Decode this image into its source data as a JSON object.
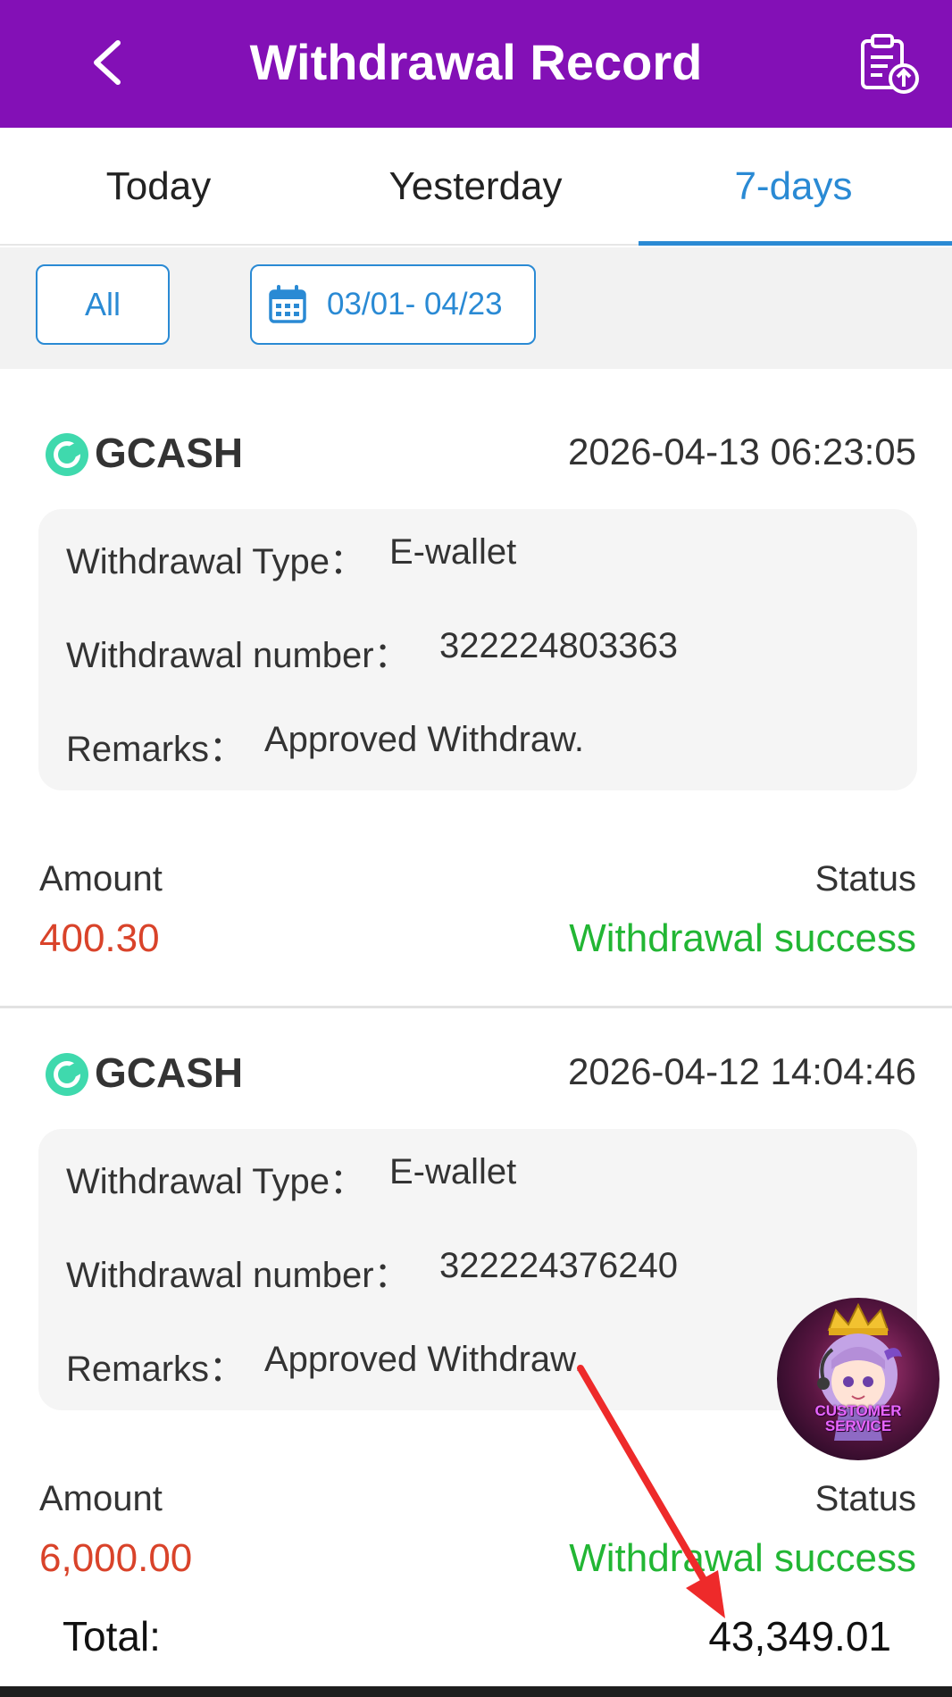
{
  "header": {
    "title": "Withdrawal Record",
    "back_icon": "chevron-left-icon",
    "upload_icon": "clipboard-upload-icon",
    "background_color": "#8310b6"
  },
  "tabs": [
    {
      "label": "Today",
      "active": false
    },
    {
      "label": "Yesterday",
      "active": false
    },
    {
      "label": "7-days",
      "active": true
    }
  ],
  "filters": {
    "type_label": "All",
    "date_range": "03/01- 04/23",
    "date_icon": "calendar-icon"
  },
  "records": [
    {
      "method": "GCASH",
      "datetime": "2026-04-13 06:23:05",
      "type_label": "Withdrawal Type：",
      "type_value": "E-wallet",
      "number_label": "Withdrawal number：",
      "number_value": "322224803363",
      "remarks_label": "Remarks：",
      "remarks_value": "Approved Withdraw.",
      "amount_label": "Amount",
      "amount": "400.30",
      "status_label": "Status",
      "status": "Withdrawal success"
    },
    {
      "method": "GCASH",
      "datetime": "2026-04-12 14:04:46",
      "type_label": "Withdrawal Type：",
      "type_value": "E-wallet",
      "number_label": "Withdrawal number：",
      "number_value": "322224376240",
      "remarks_label": "Remarks：",
      "remarks_value": "Approved Withdraw.",
      "amount_label": "Amount",
      "amount": "6,000.00",
      "status_label": "Status",
      "status": "Withdrawal success"
    }
  ],
  "total": {
    "label": "Total:",
    "value": "43,349.01"
  },
  "customer_service": {
    "line1": "CUSTOMER",
    "line2": "SERVICE"
  },
  "colors": {
    "accent_blue": "#2a8ad4",
    "amount_red": "#d9432a",
    "status_green": "#22b634",
    "annotation_arrow": "#ee2a2a"
  }
}
